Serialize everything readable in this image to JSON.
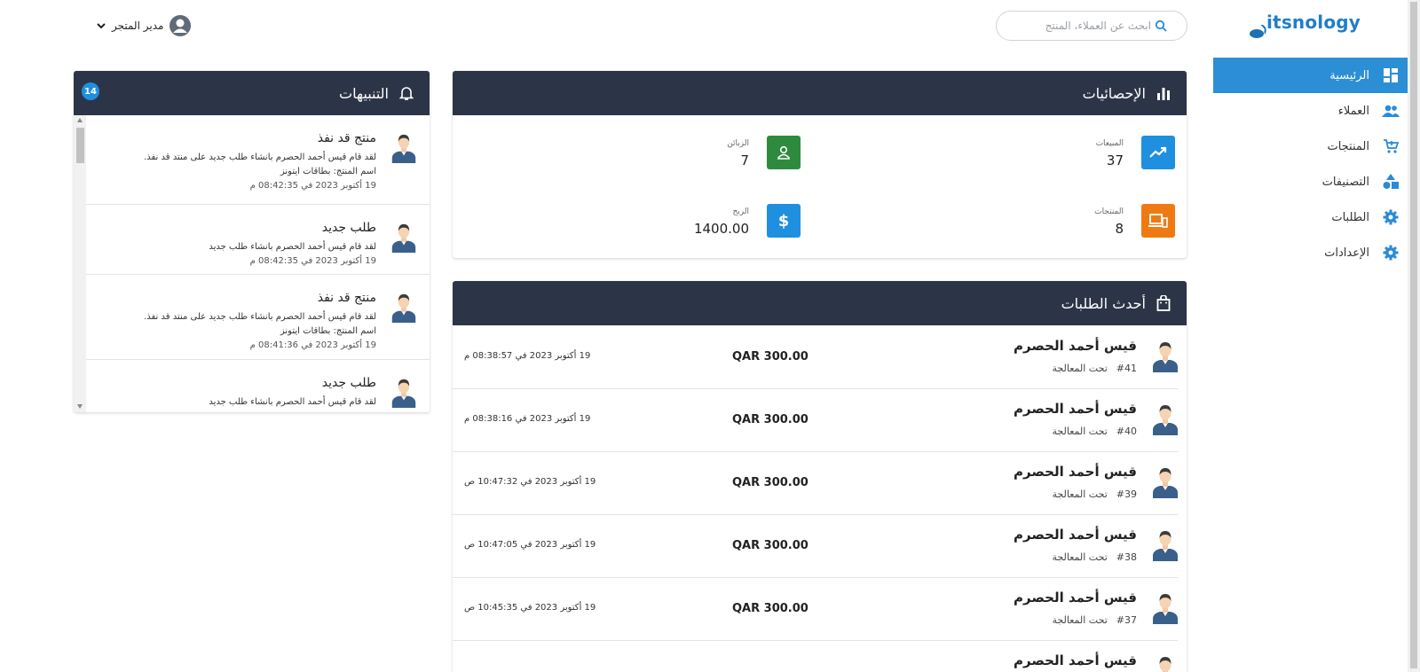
{
  "brand": {
    "logo_text": "itsnology"
  },
  "search": {
    "placeholder": "ابحث عن العملاء، المنتج"
  },
  "user": {
    "name": "مدير المتجر"
  },
  "sidebar": {
    "items": [
      {
        "label": "الرئيسية",
        "icon": "dashboard-icon",
        "active": true
      },
      {
        "label": "العملاء",
        "icon": "users-icon"
      },
      {
        "label": "المنتجات",
        "icon": "cart-icon"
      },
      {
        "label": "التصنيفات",
        "icon": "shapes-icon"
      },
      {
        "label": "الطلبات",
        "icon": "gear-icon"
      },
      {
        "label": "الإعدادات",
        "icon": "gear-icon"
      }
    ]
  },
  "stats": {
    "title": "الإحصائيات",
    "items": [
      {
        "label": "المبيعات",
        "value": "37",
        "icon": "trending-up-icon",
        "color": "#1f8fe0"
      },
      {
        "label": "الزبائن",
        "value": "7",
        "icon": "person-icon",
        "color": "#2e8b3d"
      },
      {
        "label": "المنتجات",
        "value": "8",
        "icon": "devices-icon",
        "color": "#f07a12"
      },
      {
        "label": "الربح",
        "value": "1400.00",
        "icon": "dollar-icon",
        "color": "#1f8fe0"
      }
    ]
  },
  "orders": {
    "title": "أحدث الطلبات",
    "rows": [
      {
        "name": "قيس أحمد الحصرم",
        "number": "#41",
        "status": "تحت المعالجة",
        "amount": "QAR 300.00",
        "date": "19 أكتوبر 2023 في 08:38:57 م"
      },
      {
        "name": "قيس أحمد الحصرم",
        "number": "#40",
        "status": "تحت المعالجة",
        "amount": "QAR 300.00",
        "date": "19 أكتوبر 2023 في 08:38:16 م"
      },
      {
        "name": "قيس أحمد الحصرم",
        "number": "#39",
        "status": "تحت المعالجة",
        "amount": "QAR 300.00",
        "date": "19 أكتوبر 2023 في 10:47:32 ص"
      },
      {
        "name": "قيس أحمد الحصرم",
        "number": "#38",
        "status": "تحت المعالجة",
        "amount": "QAR 300.00",
        "date": "19 أكتوبر 2023 في 10:47:05 ص"
      },
      {
        "name": "قيس أحمد الحصرم",
        "number": "#37",
        "status": "تحت المعالجة",
        "amount": "QAR 300.00",
        "date": "19 أكتوبر 2023 في 10:45:35 ص"
      },
      {
        "name": "قيس أحمد الحصرم",
        "number": "",
        "status": "",
        "amount": "",
        "date": ""
      }
    ]
  },
  "notifications": {
    "title": "التنبيهات",
    "count": "14",
    "items": [
      {
        "title": "منتج قد نفذ",
        "line1": "لقد قام قيس أحمد الحصرم بانشاء طلب جديد على منتد قد نفذ.",
        "line2": "اسم المنتج: بطاقات ايتونز",
        "date": "19 أكتوبر 2023 في 08:42:35 م"
      },
      {
        "title": "طلب جديد",
        "line1": "لقد قام قيس أحمد الحصرم بانشاء طلب جديد",
        "line2": "",
        "date": "19 أكتوبر 2023 في 08:42:35 م"
      },
      {
        "title": "منتج قد نفذ",
        "line1": "لقد قام قيس أحمد الحصرم بانشاء طلب جديد على منتد قد نفذ.",
        "line2": "اسم المنتج: بطاقات ايتونز",
        "date": "19 أكتوبر 2023 في 08:41:36 م"
      },
      {
        "title": "طلب جديد",
        "line1": "لقد قام قيس أحمد الحصرم بانشاء طلب جديد",
        "line2": "",
        "date": ""
      }
    ]
  }
}
